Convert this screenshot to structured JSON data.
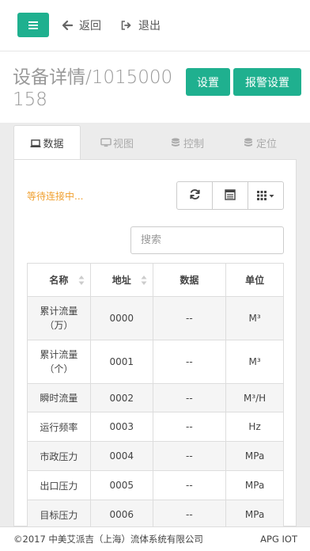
{
  "topbar": {
    "back_label": "返回",
    "logout_label": "退出"
  },
  "page": {
    "title": "设备详情/1015000158",
    "settings_button": "设置",
    "alarm_button": "报警设置"
  },
  "tabs": [
    {
      "label": "数据",
      "icon": "laptop-icon",
      "active": true
    },
    {
      "label": "视图",
      "icon": "monitor-icon",
      "active": false
    },
    {
      "label": "控制",
      "icon": "database-icon",
      "active": false
    },
    {
      "label": "定位",
      "icon": "database-icon",
      "active": false
    }
  ],
  "panel": {
    "status_text": "等待连接中...",
    "search_placeholder": "搜索",
    "toolbar": [
      "refresh-icon",
      "list-icon",
      "grid-icon"
    ]
  },
  "table": {
    "headers": [
      "名称",
      "地址",
      "数据",
      "单位"
    ],
    "rows": [
      {
        "name": "累计流量（万）",
        "address": "0000",
        "data": "--",
        "unit": "M³"
      },
      {
        "name": "累计流量（个）",
        "address": "0001",
        "data": "--",
        "unit": "M³"
      },
      {
        "name": "瞬时流量",
        "address": "0002",
        "data": "--",
        "unit": "M³/H"
      },
      {
        "name": "运行频率",
        "address": "0003",
        "data": "--",
        "unit": "Hz"
      },
      {
        "name": "市政压力",
        "address": "0004",
        "data": "--",
        "unit": "MPa"
      },
      {
        "name": "出口压力",
        "address": "0005",
        "data": "--",
        "unit": "MPa"
      },
      {
        "name": "目标压力",
        "address": "0006",
        "data": "--",
        "unit": "MPa"
      }
    ]
  },
  "footer": {
    "copyright": "©2017 中美艾派吉（上海）流体系统有限公司",
    "brand": "APG IOT"
  },
  "colors": {
    "accent": "#1fb08f",
    "status": "#f0a030"
  }
}
